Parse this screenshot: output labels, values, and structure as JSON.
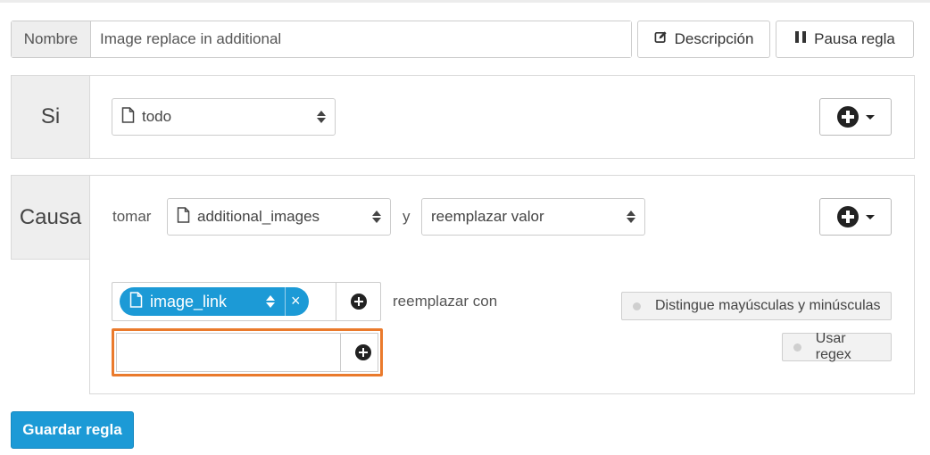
{
  "name_row": {
    "label": "Nombre",
    "value": "Image replace in additional",
    "description_button": "Descripción",
    "pause_button": "Pausa regla"
  },
  "si": {
    "label": "Si",
    "condition_select": "todo"
  },
  "causa": {
    "label": "Causa",
    "take_label": "tomar",
    "field_select": "additional_images",
    "and_label": "y",
    "action_select": "reemplazar valor",
    "find_tag": "image_link",
    "replace_with_label": "reemplazar con",
    "replace_value": "",
    "case_sensitive_toggle": "Distingue mayúsculas y minúsculas",
    "regex_toggle": "Usar regex"
  },
  "footer": {
    "save_button": "Guardar regla"
  },
  "colors": {
    "primary": "#1c9ad6",
    "highlight_border": "#ea7a2c"
  },
  "icons": [
    "pencil-square-icon",
    "pause-icon",
    "file-icon",
    "sort-icon",
    "plus-circle-icon",
    "caret-down-icon",
    "close-icon"
  ]
}
